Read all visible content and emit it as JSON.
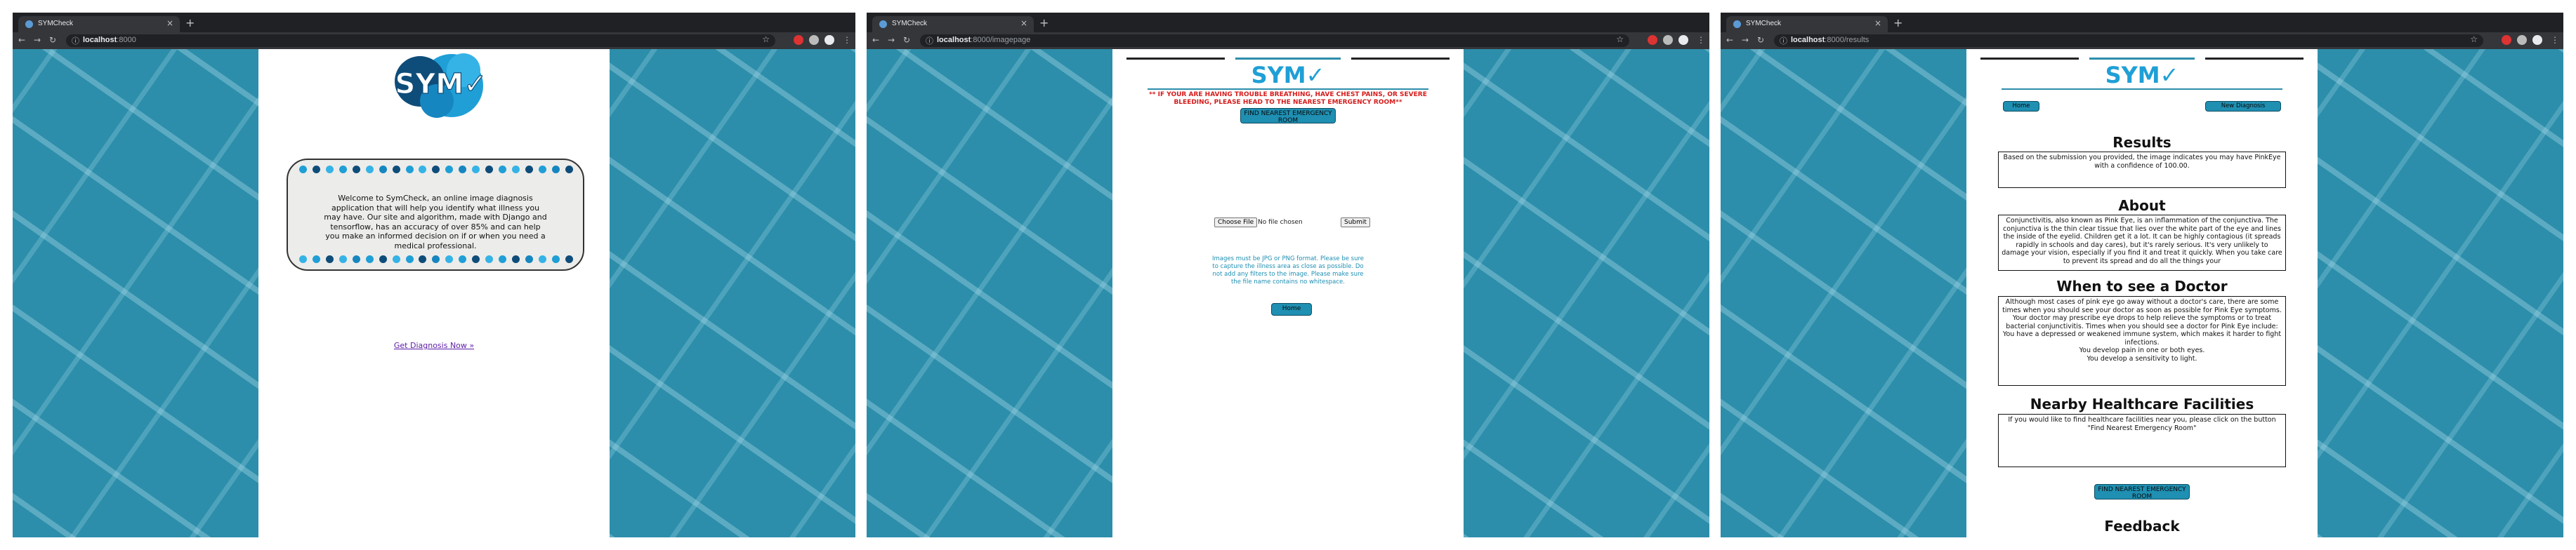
{
  "browser": {
    "tab_title": "SYMCheck",
    "tab_close": "×",
    "new_tab": "+",
    "info_icon": "ⓘ",
    "star_icon": "☆",
    "nav": {
      "back": "←",
      "forward": "→",
      "reload": "↻",
      "menu": "⋮"
    },
    "windows": [
      {
        "host": "localhost",
        "path": ":8000"
      },
      {
        "host": "localhost",
        "path": ":8000/imagepage"
      },
      {
        "host": "localhost",
        "path": ":8000/results"
      }
    ]
  },
  "colors": {
    "brand": "#2c8eaa",
    "button": "#1f8fb2",
    "warning": "#d61b1b"
  },
  "logo": {
    "text": "SYM",
    "check": "✓"
  },
  "home": {
    "welcome": "Welcome to SymCheck, an online image diagnosis application that will help you identify what illness you may have. Our site and algorithm, made with Django and tensorflow, has an accuracy of over 85% and can help you make an informed decision on if or when you need a medical professional.",
    "get_diagnosis": "Get Diagnosis Now »"
  },
  "imagepage": {
    "warning": "** IF YOUR ARE HAVING TROUBLE BREATHING, HAVE CHEST PAINS, OR SEVERE BLEEDING, PLEASE HEAD TO THE NEAREST EMERGENCY ROOM**",
    "er_button": "FIND NEAREST EMERGENCY ROOM",
    "choose_file": "Choose File",
    "no_file": "No file chosen",
    "submit": "Submit",
    "hint": "Images must be JPG or PNG format. Please be sure to capture the illness area as close as possible. Do not add any filters to the image. Please make sure the file name contains no whitespace.",
    "home_button": "Home"
  },
  "results": {
    "home_button": "Home",
    "new_diagnosis": "New Diagnosis",
    "results_title": "Results",
    "results_text": "Based on the submission you provided, the image indicates you may have PinkEye with a confidence of 100.00.",
    "about_title": "About",
    "about_text": "Conjunctivitis, also known as Pink Eye, is an inflammation of the conjunctiva. The conjunctiva is the thin clear tissue that lies over the white part of the eye and lines the inside of the eyelid. Children get it a lot. It can be highly contagious (it spreads rapidly in schools and day cares), but it's rarely serious. It's very unlikely to damage your vision, especially if you find it and treat it quickly. When you take care to prevent its spread and do all the things your",
    "doctor_title": "When to see a Doctor",
    "doctor_intro": "Although most cases of pink eye go away without a doctor's care, there are some times when you should see your doctor as soon as possible for Pink Eye symptoms. Your doctor may prescribe eye drops to help relieve the symptoms or to treat bacterial conjunctivitis. Times when you should see a doctor for Pink Eye include:",
    "doctor_items": [
      "You have a depressed or weakened immune system, which makes it harder to fight infections.",
      "You develop pain in one or both eyes.",
      "You develop a sensitivity to light."
    ],
    "facilities_title": "Nearby Healthcare Facilities",
    "facilities_text": "If you would like to find healthcare facilities near you, please click on the button \"Find Nearest Emergency Room\"",
    "er_button": "FIND NEAREST EMERGENCY ROOM",
    "feedback_title": "Feedback"
  }
}
